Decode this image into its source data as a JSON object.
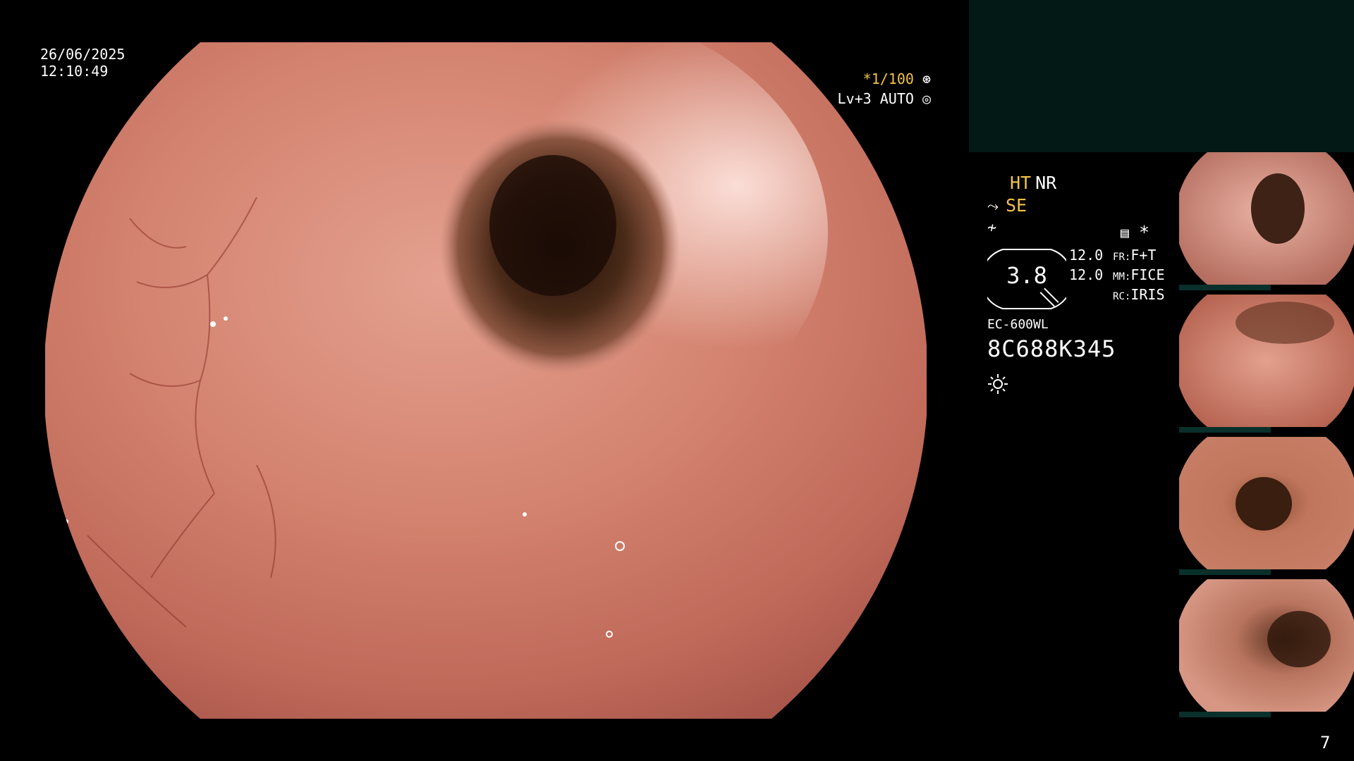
{
  "overlay": {
    "date": "26/06/2025",
    "time": "12:10:49",
    "shutter": "*1/100",
    "level": "Lv+3 AUTO"
  },
  "panel": {
    "ht": "HT",
    "nr": "NR",
    "se": "SE",
    "aperture_value": "3.8",
    "params": [
      {
        "value": "12.0",
        "key": "FR:",
        "val": "F+T"
      },
      {
        "value": "12.0",
        "key": "MM:",
        "val": "FICE"
      },
      {
        "value": "",
        "key": "RC:",
        "val": "IRIS"
      }
    ],
    "scope_model": "EC-600WL",
    "scope_serial": "8C688K345"
  },
  "page_number": "7",
  "colors": {
    "tissue": "#c87a6c",
    "lumen": "#3a1d10",
    "accent": "#f3c34a",
    "teal": "#031915"
  },
  "icons": [
    "aperture-icon",
    "auto-exposure-icon",
    "tilde-icon",
    "wave-icon",
    "menu-icon",
    "asterisk-icon",
    "sun-icon"
  ]
}
